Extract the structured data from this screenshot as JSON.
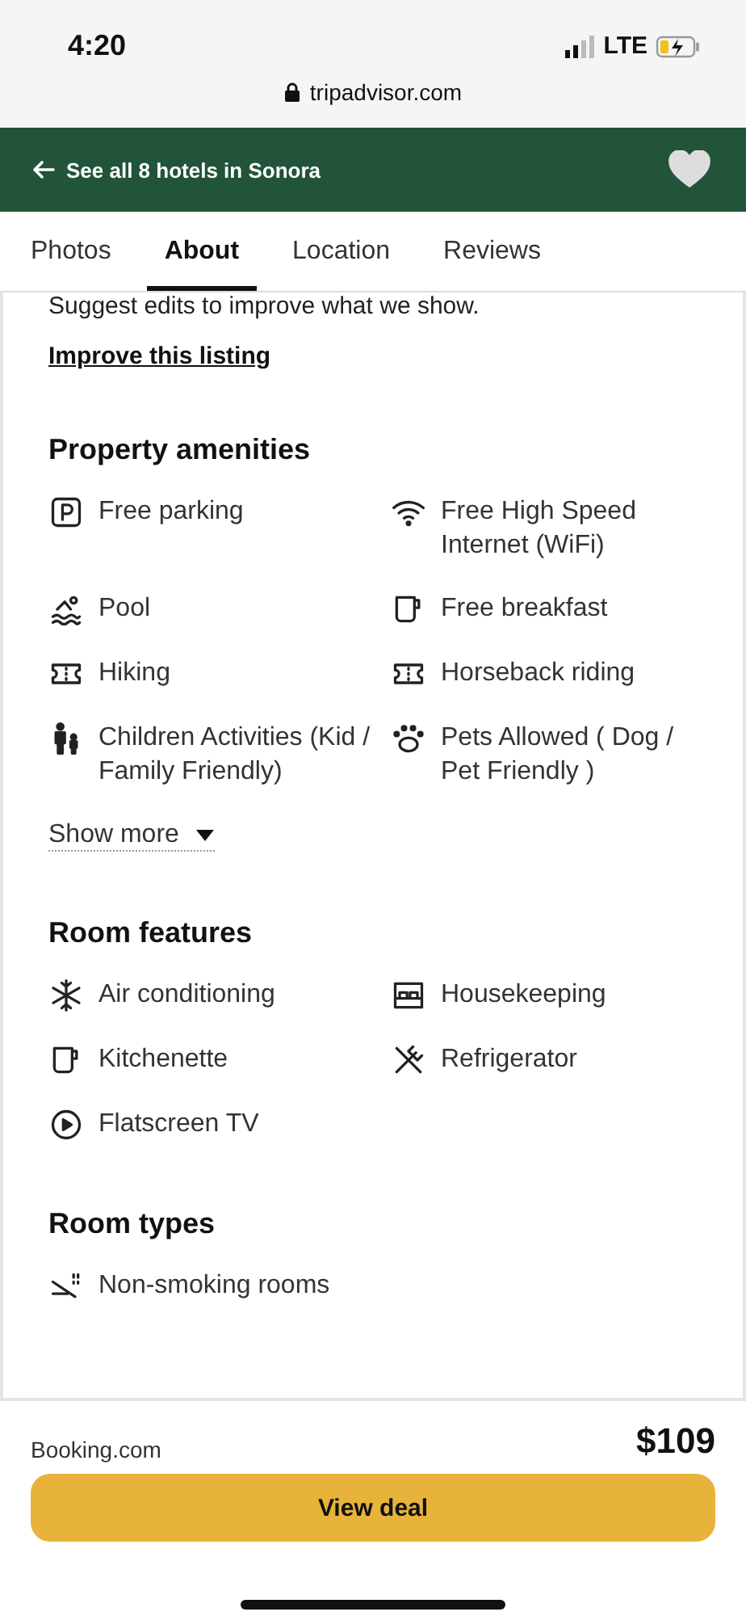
{
  "status_bar": {
    "time": "4:20",
    "network": "LTE",
    "url": "tripadvisor.com"
  },
  "header": {
    "back_link": "See all 8 hotels in Sonora",
    "saved": false
  },
  "tabs": [
    {
      "label": "Photos",
      "selected": false
    },
    {
      "label": "About",
      "selected": true
    },
    {
      "label": "Location",
      "selected": false
    },
    {
      "label": "Reviews",
      "selected": false
    }
  ],
  "intro": {
    "text": "Suggest edits to improve what we show.",
    "link": "Improve this listing"
  },
  "sections": [
    {
      "title": "Property amenities",
      "items": [
        {
          "label": "Free parking",
          "kind": "parking"
        },
        {
          "label": "Free High Speed Internet (WiFi)",
          "kind": "wifi"
        },
        {
          "label": "Pool",
          "kind": "pool"
        },
        {
          "label": "Free breakfast",
          "kind": "cup"
        },
        {
          "label": "Hiking",
          "kind": "ticket"
        },
        {
          "label": "Horseback riding",
          "kind": "ticket"
        },
        {
          "label": "Children Activities (Kid / Family Friendly)",
          "kind": "family"
        },
        {
          "label": "Pets Allowed ( Dog / Pet Friendly )",
          "kind": "paw"
        }
      ],
      "show_more": "Show more"
    },
    {
      "title": "Room features",
      "items": [
        {
          "label": "Air conditioning",
          "kind": "snowflake"
        },
        {
          "label": "Housekeeping",
          "kind": "bed"
        },
        {
          "label": "Kitchenette",
          "kind": "cup"
        },
        {
          "label": "Refrigerator",
          "kind": "utensils"
        },
        {
          "label": "Flatscreen TV",
          "kind": "play"
        }
      ]
    },
    {
      "title": "Room types",
      "items": [
        {
          "label": "Non-smoking rooms",
          "kind": "nosmoke"
        }
      ]
    }
  ],
  "deal": {
    "provider": "Booking.com",
    "price": "$109",
    "button": "View deal"
  }
}
